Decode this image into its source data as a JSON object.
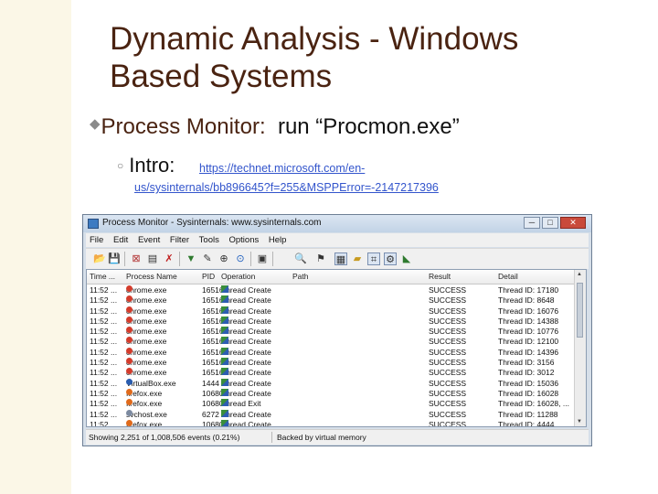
{
  "slide": {
    "title_line1": "Dynamic Analysis - Windows",
    "title_line2": "Based Systems",
    "bullet1_label": "Process Monitor:",
    "bullet1_text": "run “Procmon.exe”",
    "bullet2_label": "Intro:",
    "link_line1": "https://technet.microsoft.com/en-",
    "link_line2": "us/sysinternals/bb896645?f=255&MSPPError=-2147217396"
  },
  "window": {
    "title": "Process Monitor - Sysinternals: www.sysinternals.com",
    "buttons": {
      "minimize": "─",
      "maximize": "□",
      "close": "✕"
    },
    "menu": [
      "File",
      "Edit",
      "Event",
      "Filter",
      "Tools",
      "Options",
      "Help"
    ],
    "toolbar_icons": [
      "open-icon",
      "save-icon",
      "capture-icon",
      "autoscroll-icon",
      "clear-icon",
      "filter-icon",
      "highlight-icon",
      "include-process-icon",
      "network-icon",
      "jump-icon",
      "find-icon",
      "process-tree-icon",
      "registry-activity-icon",
      "file-activity-icon",
      "network-activity-icon",
      "process-activity-icon",
      "profiling-icon"
    ],
    "columns": [
      "Time ...",
      "Process Name",
      "PID",
      "Operation",
      "Path",
      "Result",
      "Detail"
    ],
    "rows": [
      {
        "time": "11:52 ...",
        "proc": "chrome.exe",
        "pid": "16516",
        "op": "Thread Create",
        "result": "SUCCESS",
        "detail": "Thread ID: 17180",
        "icon": "chrome"
      },
      {
        "time": "11:52 ...",
        "proc": "chrome.exe",
        "pid": "16516",
        "op": "Thread Create",
        "result": "SUCCESS",
        "detail": "Thread ID: 8648",
        "icon": "chrome"
      },
      {
        "time": "11:52 ...",
        "proc": "chrome.exe",
        "pid": "16516",
        "op": "Thread Create",
        "result": "SUCCESS",
        "detail": "Thread ID: 16076",
        "icon": "chrome"
      },
      {
        "time": "11:52 ...",
        "proc": "chrome.exe",
        "pid": "16516",
        "op": "Thread Create",
        "result": "SUCCESS",
        "detail": "Thread ID: 14388",
        "icon": "chrome"
      },
      {
        "time": "11:52 ...",
        "proc": "chrome.exe",
        "pid": "16516",
        "op": "Thread Create",
        "result": "SUCCESS",
        "detail": "Thread ID: 10776",
        "icon": "chrome"
      },
      {
        "time": "11:52 ...",
        "proc": "chrome.exe",
        "pid": "16516",
        "op": "Thread Create",
        "result": "SUCCESS",
        "detail": "Thread ID: 12100",
        "icon": "chrome"
      },
      {
        "time": "11:52 ...",
        "proc": "chrome.exe",
        "pid": "16516",
        "op": "Thread Create",
        "result": "SUCCESS",
        "detail": "Thread ID: 14396",
        "icon": "chrome"
      },
      {
        "time": "11:52 ...",
        "proc": "chrome.exe",
        "pid": "16516",
        "op": "Thread Create",
        "result": "SUCCESS",
        "detail": "Thread ID: 3156",
        "icon": "chrome"
      },
      {
        "time": "11:52 ...",
        "proc": "chrome.exe",
        "pid": "16516",
        "op": "Thread Create",
        "result": "SUCCESS",
        "detail": "Thread ID: 3012",
        "icon": "chrome"
      },
      {
        "time": "11:52 ...",
        "proc": "VirtualBox.exe",
        "pid": "1444",
        "op": "Thread Create",
        "result": "SUCCESS",
        "detail": "Thread ID: 15036",
        "icon": "vbox"
      },
      {
        "time": "11:52 ...",
        "proc": "firefox.exe",
        "pid": "10680",
        "op": "Thread Create",
        "result": "SUCCESS",
        "detail": "Thread ID: 16028",
        "icon": "firefox"
      },
      {
        "time": "11:52 ...",
        "proc": "firefox.exe",
        "pid": "10680",
        "op": "Thread Exit",
        "result": "SUCCESS",
        "detail": "Thread ID: 16028, ...",
        "icon": "firefox"
      },
      {
        "time": "11:52 ...",
        "proc": "svchost.exe",
        "pid": "6272",
        "op": "Thread Create",
        "result": "SUCCESS",
        "detail": "Thread ID: 11288",
        "icon": "svchost"
      },
      {
        "time": "11:52 ...",
        "proc": "firefox.exe",
        "pid": "10680",
        "op": "Thread Create",
        "result": "SUCCESS",
        "detail": "Thread ID: 4444",
        "icon": "firefox"
      }
    ],
    "status_left": "Showing 2,251 of 1,008,506 events (0.21%)",
    "status_right": "Backed by virtual memory"
  },
  "colors": {
    "title": "#4a2311",
    "link": "#3355cc",
    "band": "#fbf7e7",
    "chrome_icon": "#d33c2c",
    "firefox_icon": "#e06a1b",
    "vbox_icon": "#2a5db0",
    "svchost_icon": "#7c8aa0"
  }
}
